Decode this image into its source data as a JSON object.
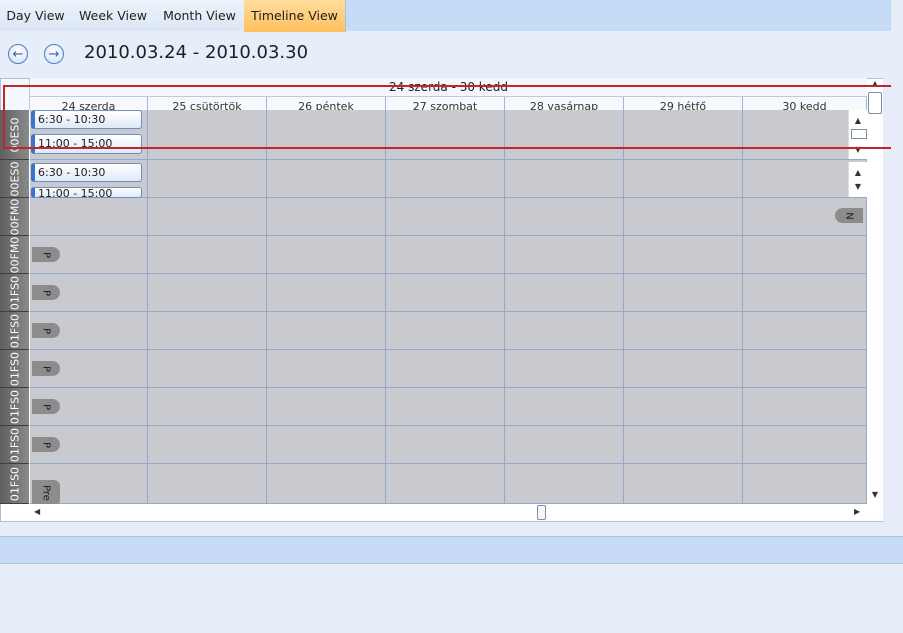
{
  "tabs": [
    {
      "label": "Day View",
      "active": false
    },
    {
      "label": "Week View",
      "active": false
    },
    {
      "label": "Month View",
      "active": false
    },
    {
      "label": "Timeline View",
      "active": true
    }
  ],
  "nav": {
    "prev_icon": "arrow-left-icon",
    "next_icon": "arrow-right-icon",
    "date_range": "2010.03.24 - 2010.03.30"
  },
  "timeline": {
    "range_header": "24 szerda - 30 kedd",
    "day_headers": [
      "24 szerda",
      "25 csütörtök",
      "26 péntek",
      "27 szombat",
      "28 vasárnap",
      "29 hétfő",
      "30 kedd"
    ],
    "resources": [
      {
        "label": "00ES0"
      },
      {
        "label": "00ES0"
      },
      {
        "label": "00FM0"
      },
      {
        "label": "00FM0"
      },
      {
        "label": "01FS0"
      },
      {
        "label": "01FS0"
      },
      {
        "label": "01FS0"
      },
      {
        "label": "01FS0"
      },
      {
        "label": "01FS0"
      },
      {
        "label": "01FS0"
      }
    ],
    "appointments": [
      {
        "row": 0,
        "time": "6:30 - 10:30"
      },
      {
        "row": 0,
        "time": "11:00 - 15:00"
      },
      {
        "row": 1,
        "time": "6:30 - 10:30"
      },
      {
        "row": 1,
        "time": "11:00 - 15:00"
      }
    ],
    "more_indicators": [
      "N",
      "P",
      "P",
      "P",
      "P",
      "P",
      "P",
      "Pre"
    ]
  },
  "colors": {
    "active_tab": "#ffc060",
    "cell_bg": "#c9cacf",
    "resource_header": "#6e6e6e",
    "appointment_accent": "#3c72c8",
    "selection_box": "#c0262c"
  }
}
